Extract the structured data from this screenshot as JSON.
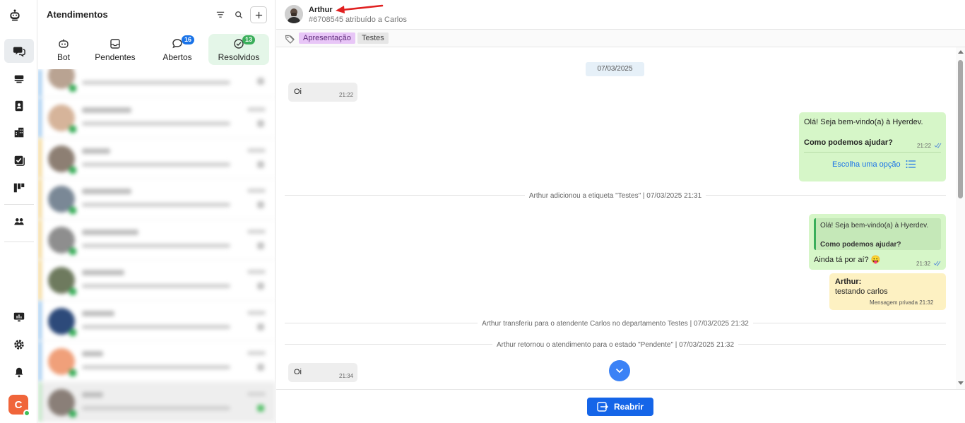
{
  "colors": {
    "accent": "#1565e8",
    "active_tab_bg": "#e4f6e8",
    "outgoing_bubble": "#d6f6c8",
    "private_bubble": "#fdf1c2"
  },
  "rail": {
    "icons": [
      "logo-icon",
      "chat-icon",
      "inbox-icon",
      "contacts-icon",
      "building-icon",
      "tasks-icon",
      "kanban-icon",
      "team-icon",
      "monitor-icon",
      "gear-icon",
      "bell-icon"
    ],
    "avatar_letter": "C"
  },
  "list": {
    "title": "Atendimentos",
    "tabs": [
      {
        "label": "Bot",
        "badge": ""
      },
      {
        "label": "Pendentes",
        "badge": ""
      },
      {
        "label": "Abertos",
        "badge": "16"
      },
      {
        "label": "Resolvidos",
        "badge": "13"
      }
    ]
  },
  "chat": {
    "contact_name": "Arthur",
    "subtitle": "#6708545 atribuído a Carlos",
    "tags": [
      "Apresentação",
      "Testes"
    ],
    "date": "07/03/2025",
    "messages": {
      "m1_text": "Oi",
      "m1_time": "21:22",
      "m2_line1": "Olá! Seja bem-vindo(a) à Hyerdev.",
      "m2_line2": "Como podemos ajudar?",
      "m2_time": "21:22",
      "m2_button": "Escolha uma opção",
      "sys1": "Arthur adicionou a etiqueta \"Testes\" | 07/03/2025 21:31",
      "m3_quote1": "Olá! Seja bem-vindo(a) à Hyerdev.",
      "m3_quote2": "Como podemos ajudar?",
      "m3_text": "Ainda tá por aí? 😛",
      "m3_time": "21:32",
      "m4_author": "Arthur:",
      "m4_text": "testando carlos",
      "m4_footer": "Mensagem privada 21:32",
      "sys2": "Arthur transferiu para o atendente Carlos no departamento Testes | 07/03/2025 21:32",
      "sys3": "Arthur retornou o atendimento para o estado \"Pendente\" | 07/03/2025 21:32",
      "m5_text": "Oi",
      "m5_time": "21:34"
    },
    "reopen_label": "Reabrir"
  }
}
